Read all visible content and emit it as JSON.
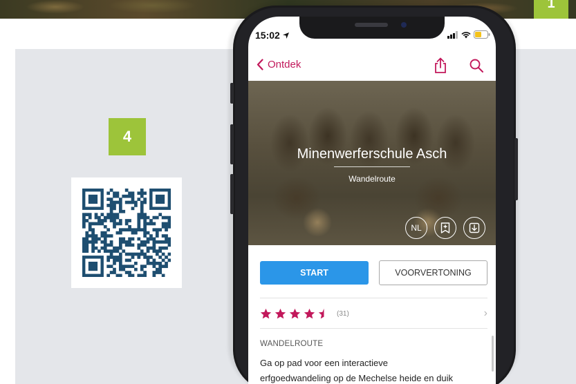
{
  "corner_badge": {
    "label": "1"
  },
  "step_badge": {
    "label": "4"
  },
  "qr": {
    "icon": "qr-code-icon"
  },
  "status_bar": {
    "time": "15:02",
    "icons": [
      "location-arrow-icon",
      "signal-icon",
      "wifi-icon",
      "battery-icon"
    ]
  },
  "nav": {
    "back_label": "Ontdek",
    "actions": [
      "share-icon",
      "search-icon"
    ]
  },
  "hero": {
    "title": "Minenwerferschule Asch",
    "subtitle": "Wandelroute",
    "buttons": [
      {
        "label": "NL",
        "name": "language-button"
      },
      {
        "label": "",
        "name": "bookmark-button"
      },
      {
        "label": "",
        "name": "download-button"
      }
    ]
  },
  "actions": {
    "start_label": "START",
    "preview_label": "VOORVERTONING"
  },
  "rating": {
    "stars": 4.5,
    "max": 5,
    "count": "(31)"
  },
  "section": {
    "label": "WANDELROUTE",
    "line1": "Ga op pad voor een interactieve",
    "line2": "erfgoedwandeling op de Mechelse heide en duik"
  },
  "colors": {
    "accent": "#c2185b",
    "start_button": "#2b96e8",
    "badge_green": "#9dc43a",
    "panel_bg": "#e4e6ea",
    "qr_color": "#1e4e70"
  }
}
